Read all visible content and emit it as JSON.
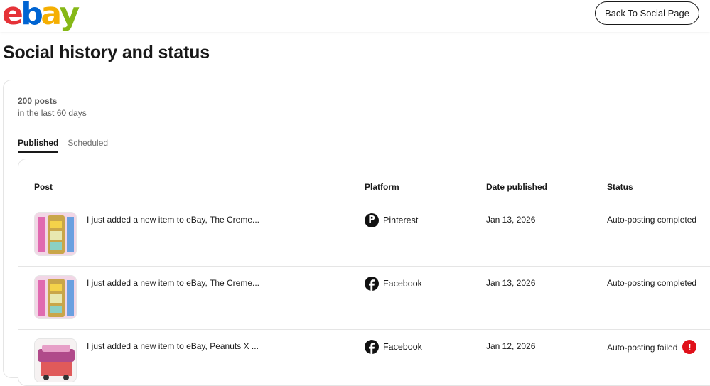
{
  "header": {
    "logo_letters": [
      {
        "char": "e",
        "color": "#e53238"
      },
      {
        "char": "b",
        "color": "#0064d2"
      },
      {
        "char": "a",
        "color": "#f5af02"
      },
      {
        "char": "y",
        "color": "#86b817"
      }
    ],
    "back_button_label": "Back To Social Page"
  },
  "page": {
    "title": "Social history and status"
  },
  "summary": {
    "count": "200 posts",
    "range": "in the last 60 days"
  },
  "tabs": [
    {
      "label": "Published",
      "active": true
    },
    {
      "label": "Scheduled",
      "active": false
    }
  ],
  "table": {
    "columns": {
      "post": "Post",
      "platform": "Platform",
      "date": "Date published",
      "status": "Status"
    },
    "rows": [
      {
        "post": "I just added a new item to eBay, The Creme...",
        "platform": "Pinterest",
        "platform_icon": "pinterest-icon",
        "date": "Jan 13, 2026",
        "status": "Auto-posting completed",
        "error": false
      },
      {
        "post": "I just added a new item to eBay, The Creme...",
        "platform": "Facebook",
        "platform_icon": "facebook-icon",
        "date": "Jan 13, 2026",
        "status": "Auto-posting completed",
        "error": false
      },
      {
        "post": "I just added a new item to eBay, Peanuts X ...",
        "platform": "Facebook",
        "platform_icon": "facebook-icon",
        "date": "Jan 12, 2026",
        "status": "Auto-posting failed",
        "error": true
      }
    ]
  },
  "colors": {
    "error": "#e0101a",
    "border": "#e5e5e5",
    "text": "#191919"
  }
}
